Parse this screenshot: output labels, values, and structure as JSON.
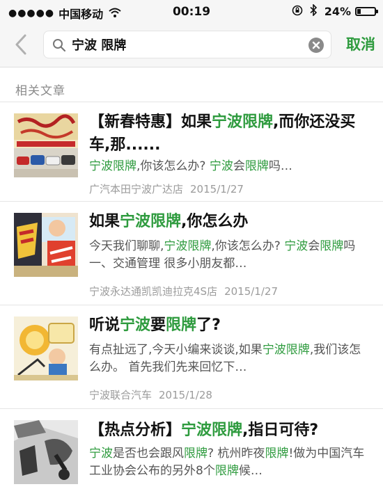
{
  "status_bar": {
    "carrier": "中国移动",
    "time": "00:19",
    "battery_percent": "24%",
    "battery_level": 0.24,
    "icons": [
      "signal-dots-icon",
      "wifi-icon",
      "orientation-lock-icon",
      "bluetooth-icon",
      "battery-icon"
    ]
  },
  "search": {
    "query": "宁波 限牌",
    "cancel_label": "取消",
    "icons": [
      "back-chevron-icon",
      "search-icon",
      "clear-icon"
    ]
  },
  "results": {
    "section_label": "相关文章",
    "highlight_color": "#2e9b3e",
    "articles": [
      {
        "thumb_icon": "new-year-banner-thumbnail",
        "title": [
          "【新春特惠】如果",
          "宁波限牌",
          ",而你还没买车,那......"
        ],
        "snippet": [
          "宁波限牌",
          ",你该怎么办? ",
          "宁波",
          "会",
          "限牌",
          "吗…"
        ],
        "source": "广汽本田宁波广达店",
        "date": "2015/1/27"
      },
      {
        "thumb_icon": "comic-collage-thumbnail",
        "title": [
          "如果",
          "宁波限牌",
          ",你怎么办"
        ],
        "snippet": [
          "今天我们聊聊,",
          "宁波限牌",
          ",你该怎么办? ",
          "宁波",
          "会",
          "限牌",
          "吗 一、交通管理 很多小朋友都…"
        ],
        "source": "宁波永达通凯凯迪拉克4S店",
        "date": "2015/1/27"
      },
      {
        "thumb_icon": "cartoon-illustration-thumbnail",
        "title": [
          "听说",
          "宁波",
          "要",
          "限牌",
          "了?"
        ],
        "snippet": [
          "有点扯远了,今天小编来谈谈,如果",
          "宁波限牌",
          ",我们该怎么办。 首先我们先来回忆下…"
        ],
        "source": "宁波联合汽车",
        "date": "2015/1/28"
      },
      {
        "thumb_icon": "hotspot-analysis-thumbnail",
        "title": [
          "【热点分析】",
          "宁波限牌",
          ",指日可待?"
        ],
        "snippet": [
          "宁波",
          "是否也会跟风",
          "限牌",
          "? 杭州昨夜",
          "限牌",
          "!做为中国汽车工业协会公布的另外8个",
          "限牌",
          "候…"
        ],
        "source": "",
        "date": ""
      }
    ]
  }
}
